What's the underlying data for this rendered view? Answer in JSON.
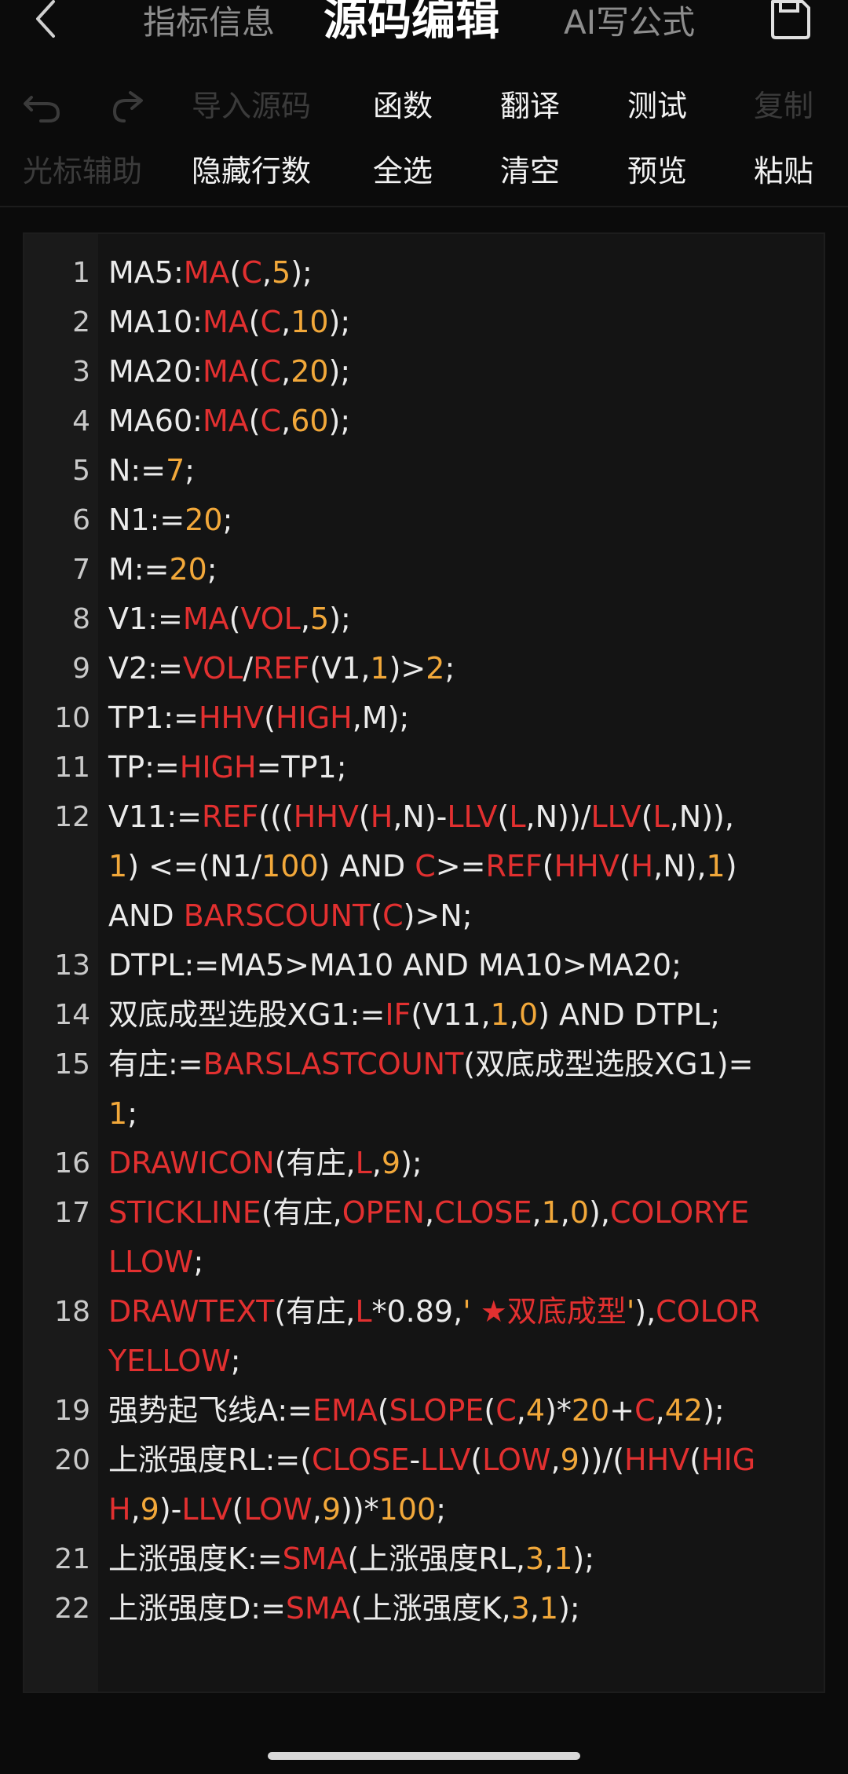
{
  "header": {
    "tabs": [
      {
        "label": "指标信息"
      },
      {
        "label": "源码编辑"
      },
      {
        "label": "AI写公式"
      }
    ]
  },
  "toolbar": {
    "row1": {
      "undo_icon": "undo-icon",
      "redo_icon": "redo-icon",
      "import_label": "导入源码",
      "function_label": "函数",
      "translate_label": "翻译",
      "test_label": "测试",
      "copy_label": "复制"
    },
    "row2": {
      "cursor_label": "光标辅助",
      "hide_lines_label": "隐藏行数",
      "select_all_label": "全选",
      "clear_label": "清空",
      "preview_label": "预览",
      "paste_label": "粘贴"
    }
  },
  "colors": {
    "background": "#0b0b0b",
    "editor_bg": "#141414",
    "gutter_bg": "#1a1a1a",
    "text": "#ebebeb",
    "function": "#e23030",
    "number": "#f2a83a",
    "disabled": "#3b3b3b"
  },
  "code_lines": [
    {
      "n": "1",
      "tokens": [
        [
          "t",
          "MA5:"
        ],
        [
          "f",
          "MA"
        ],
        [
          "t",
          "("
        ],
        [
          "f",
          "C"
        ],
        [
          "t",
          ","
        ],
        [
          "n",
          "5"
        ],
        [
          "t",
          ");"
        ]
      ]
    },
    {
      "n": "2",
      "tokens": [
        [
          "t",
          "MA10:"
        ],
        [
          "f",
          "MA"
        ],
        [
          "t",
          "("
        ],
        [
          "f",
          "C"
        ],
        [
          "t",
          ","
        ],
        [
          "n",
          "10"
        ],
        [
          "t",
          ");"
        ]
      ]
    },
    {
      "n": "3",
      "tokens": [
        [
          "t",
          "MA20:"
        ],
        [
          "f",
          "MA"
        ],
        [
          "t",
          "("
        ],
        [
          "f",
          "C"
        ],
        [
          "t",
          ","
        ],
        [
          "n",
          "20"
        ],
        [
          "t",
          ");"
        ]
      ]
    },
    {
      "n": "4",
      "tokens": [
        [
          "t",
          "MA60:"
        ],
        [
          "f",
          "MA"
        ],
        [
          "t",
          "("
        ],
        [
          "f",
          "C"
        ],
        [
          "t",
          ","
        ],
        [
          "n",
          "60"
        ],
        [
          "t",
          ");"
        ]
      ]
    },
    {
      "n": "5",
      "tokens": [
        [
          "t",
          "N:="
        ],
        [
          "n",
          "7"
        ],
        [
          "t",
          ";"
        ]
      ]
    },
    {
      "n": "6",
      "tokens": [
        [
          "t",
          "N1:="
        ],
        [
          "n",
          "20"
        ],
        [
          "t",
          ";"
        ]
      ]
    },
    {
      "n": "7",
      "tokens": [
        [
          "t",
          "M:="
        ],
        [
          "n",
          "20"
        ],
        [
          "t",
          ";"
        ]
      ]
    },
    {
      "n": "8",
      "tokens": [
        [
          "t",
          "V1:="
        ],
        [
          "f",
          "MA"
        ],
        [
          "t",
          "("
        ],
        [
          "f",
          "VOL"
        ],
        [
          "t",
          ","
        ],
        [
          "n",
          "5"
        ],
        [
          "t",
          ");"
        ]
      ]
    },
    {
      "n": "9",
      "tokens": [
        [
          "t",
          "V2:="
        ],
        [
          "f",
          "VOL"
        ],
        [
          "t",
          "/"
        ],
        [
          "f",
          "REF"
        ],
        [
          "t",
          "(V1,"
        ],
        [
          "n",
          "1"
        ],
        [
          "t",
          ")>"
        ],
        [
          "n",
          "2"
        ],
        [
          "t",
          ";"
        ]
      ]
    },
    {
      "n": "10",
      "tokens": [
        [
          "t",
          "TP1:="
        ],
        [
          "f",
          "HHV"
        ],
        [
          "t",
          "("
        ],
        [
          "f",
          "HIGH"
        ],
        [
          "t",
          ",M);"
        ]
      ]
    },
    {
      "n": "11",
      "tokens": [
        [
          "t",
          "TP:="
        ],
        [
          "f",
          "HIGH"
        ],
        [
          "t",
          "=TP1;"
        ]
      ]
    },
    {
      "n": "12",
      "tokens": [
        [
          "t",
          "V11:="
        ],
        [
          "f",
          "REF"
        ],
        [
          "t",
          "((("
        ],
        [
          "f",
          "HHV"
        ],
        [
          "t",
          "("
        ],
        [
          "f",
          "H"
        ],
        [
          "t",
          ",N)-"
        ],
        [
          "f",
          "LLV"
        ],
        [
          "t",
          "("
        ],
        [
          "f",
          "L"
        ],
        [
          "t",
          ",N))/"
        ],
        [
          "f",
          "LLV"
        ],
        [
          "t",
          "("
        ],
        [
          "f",
          "L"
        ],
        [
          "t",
          ",N)),"
        ],
        [
          "n",
          "1"
        ],
        [
          "t",
          ") <=(N1/"
        ],
        [
          "n",
          "100"
        ],
        [
          "t",
          ") AND "
        ],
        [
          "f",
          "C"
        ],
        [
          "t",
          ">="
        ],
        [
          "f",
          "REF"
        ],
        [
          "t",
          "("
        ],
        [
          "f",
          "HHV"
        ],
        [
          "t",
          "("
        ],
        [
          "f",
          "H"
        ],
        [
          "t",
          ",N),"
        ],
        [
          "n",
          "1"
        ],
        [
          "t",
          ") AND "
        ],
        [
          "f",
          "BARSCOUNT"
        ],
        [
          "t",
          "("
        ],
        [
          "f",
          "C"
        ],
        [
          "t",
          ")>N;"
        ]
      ]
    },
    {
      "n": "13",
      "tokens": [
        [
          "t",
          "DTPL:=MA5>MA10 AND MA10>MA20;"
        ]
      ]
    },
    {
      "n": "14",
      "tokens": [
        [
          "t",
          "双底成型选股XG1:="
        ],
        [
          "f",
          "IF"
        ],
        [
          "t",
          "(V11,"
        ],
        [
          "n",
          "1"
        ],
        [
          "t",
          ","
        ],
        [
          "n",
          "0"
        ],
        [
          "t",
          ") AND DTPL;"
        ]
      ]
    },
    {
      "n": "15",
      "tokens": [
        [
          "t",
          "有庄:="
        ],
        [
          "f",
          "BARSLASTCOUNT"
        ],
        [
          "t",
          "(双底成型选股XG1)="
        ],
        [
          "n",
          "1"
        ],
        [
          "t",
          ";"
        ]
      ]
    },
    {
      "n": "16",
      "tokens": [
        [
          "f",
          "DRAWICON"
        ],
        [
          "t",
          "(有庄,"
        ],
        [
          "f",
          "L"
        ],
        [
          "t",
          ","
        ],
        [
          "n",
          "9"
        ],
        [
          "t",
          ");"
        ]
      ]
    },
    {
      "n": "17",
      "tokens": [
        [
          "f",
          "STICKLINE"
        ],
        [
          "t",
          "(有庄,"
        ],
        [
          "f",
          "OPEN"
        ],
        [
          "t",
          ","
        ],
        [
          "f",
          "CLOSE"
        ],
        [
          "t",
          ","
        ],
        [
          "n",
          "1"
        ],
        [
          "t",
          ","
        ],
        [
          "n",
          "0"
        ],
        [
          "t",
          "),"
        ],
        [
          "f",
          "COLORYELLOW"
        ],
        [
          "t",
          ";"
        ]
      ]
    },
    {
      "n": "18",
      "tokens": [
        [
          "f",
          "DRAWTEXT"
        ],
        [
          "t",
          "(有庄,"
        ],
        [
          "f",
          "L"
        ],
        [
          "t",
          "*0.89,"
        ],
        [
          "n",
          "'"
        ],
        [
          "f",
          " ★双底成型"
        ],
        [
          "n",
          "'"
        ],
        [
          "t",
          "),"
        ],
        [
          "f",
          "COLORYELLOW"
        ],
        [
          "t",
          ";"
        ]
      ]
    },
    {
      "n": "19",
      "tokens": [
        [
          "t",
          "强势起飞线A:="
        ],
        [
          "f",
          "EMA"
        ],
        [
          "t",
          "("
        ],
        [
          "f",
          "SLOPE"
        ],
        [
          "t",
          "("
        ],
        [
          "f",
          "C"
        ],
        [
          "t",
          ","
        ],
        [
          "n",
          "4"
        ],
        [
          "t",
          ")*"
        ],
        [
          "n",
          "20"
        ],
        [
          "t",
          "+"
        ],
        [
          "f",
          "C"
        ],
        [
          "t",
          ","
        ],
        [
          "n",
          "42"
        ],
        [
          "t",
          ");"
        ]
      ]
    },
    {
      "n": "20",
      "tokens": [
        [
          "t",
          "上涨强度RL:=("
        ],
        [
          "f",
          "CLOSE"
        ],
        [
          "t",
          "-"
        ],
        [
          "f",
          "LLV"
        ],
        [
          "t",
          "("
        ],
        [
          "f",
          "LOW"
        ],
        [
          "t",
          ","
        ],
        [
          "n",
          "9"
        ],
        [
          "t",
          "))/("
        ],
        [
          "f",
          "HHV"
        ],
        [
          "t",
          "("
        ],
        [
          "f",
          "HIGH"
        ],
        [
          "t",
          ","
        ],
        [
          "n",
          "9"
        ],
        [
          "t",
          ")-"
        ],
        [
          "f",
          "LLV"
        ],
        [
          "t",
          "("
        ],
        [
          "f",
          "LOW"
        ],
        [
          "t",
          ","
        ],
        [
          "n",
          "9"
        ],
        [
          "t",
          "))*"
        ],
        [
          "n",
          "100"
        ],
        [
          "t",
          ";"
        ]
      ]
    },
    {
      "n": "21",
      "tokens": [
        [
          "t",
          "上涨强度K:="
        ],
        [
          "f",
          "SMA"
        ],
        [
          "t",
          "(上涨强度RL,"
        ],
        [
          "n",
          "3"
        ],
        [
          "t",
          ","
        ],
        [
          "n",
          "1"
        ],
        [
          "t",
          ");"
        ]
      ]
    },
    {
      "n": "22",
      "tokens": [
        [
          "t",
          "上涨强度D:="
        ],
        [
          "f",
          "SMA"
        ],
        [
          "t",
          "(上涨强度K,"
        ],
        [
          "n",
          "3"
        ],
        [
          "t",
          ","
        ],
        [
          "n",
          "1"
        ],
        [
          "t",
          ");"
        ]
      ]
    }
  ]
}
